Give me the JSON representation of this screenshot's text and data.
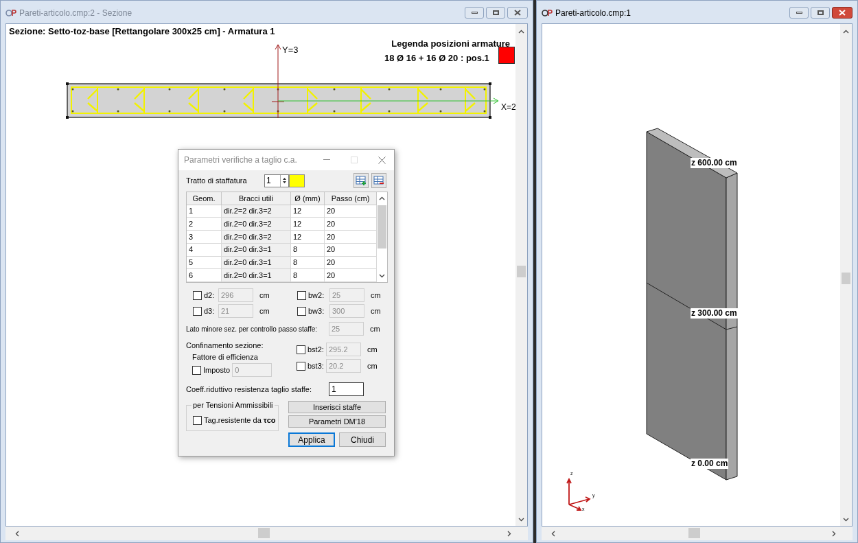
{
  "windows": [
    {
      "kind": "section",
      "title": "Pareti-articolo.cmp:2 - Sezione",
      "active": false,
      "heading": "Sezione: Setto-toz-base [Rettangolare 300x25 cm] - Armatura 1",
      "legend": {
        "title": "Legenda posizioni armature",
        "entry": "18 Ø 16 + 16 Ø 20 : pos.1",
        "color": "#ff0000"
      },
      "axis_labels": [
        "Y=3",
        "X=2"
      ]
    },
    {
      "kind": "view3d",
      "title": "Pareti-articolo.cmp:1",
      "active": true,
      "level_labels": [
        "z 600.00 cm",
        "z 300.00 cm",
        "z 0.00 cm"
      ],
      "axis_labels": [
        "z",
        "y",
        "x"
      ]
    }
  ],
  "dialog": {
    "title": "Parametri verifiche a taglio c.a.",
    "tratto": {
      "label": "Tratto di staffatura",
      "value": "1",
      "color": "#ffff00"
    },
    "table": {
      "columns": [
        "Geom.",
        "Bracci utili",
        "Ø (mm)",
        "Passo (cm)"
      ],
      "rows": [
        [
          "1",
          "dir.2=2 dir.3=2",
          "12",
          "20"
        ],
        [
          "2",
          "dir.2=0 dir.3=2",
          "12",
          "20"
        ],
        [
          "3",
          "dir.2=0 dir.3=2",
          "12",
          "20"
        ],
        [
          "4",
          "dir.2=0 dir.3=1",
          "8",
          "20"
        ],
        [
          "5",
          "dir.2=0 dir.3=1",
          "8",
          "20"
        ],
        [
          "6",
          "dir.2=0 dir.3=1",
          "8",
          "20"
        ]
      ]
    },
    "checked_fields": [
      {
        "label": "d2:",
        "value": "296",
        "unit": "cm",
        "checked": false
      },
      {
        "label": "bw2:",
        "value": "25",
        "unit": "cm",
        "checked": false
      },
      {
        "label": "d3:",
        "value": "21",
        "unit": "cm",
        "checked": false
      },
      {
        "label": "bw3:",
        "value": "300",
        "unit": "cm",
        "checked": false
      }
    ],
    "lato": {
      "label": "Lato minore sez. per controllo passo staffe:",
      "value": "25",
      "unit": "cm"
    },
    "confinamento": {
      "label": "Confinamento sezione:",
      "sublabel": "Fattore di efficienza",
      "imposto": {
        "label": "Imposto",
        "value": "0",
        "checked": false
      },
      "bst": [
        {
          "label": "bst2:",
          "value": "295.2",
          "unit": "cm",
          "checked": false
        },
        {
          "label": "bst3:",
          "value": "20.2",
          "unit": "cm",
          "checked": false
        }
      ]
    },
    "coeff": {
      "label": "Coeff.riduttivo resistenza taglio staffe:",
      "value": "1"
    },
    "group": {
      "title": "per Tensioni Ammissibili",
      "checkbox": {
        "label": "Tag.resistente da **τco**",
        "checked": false
      }
    },
    "buttons": [
      "Inserisci staffe",
      "Parametri DM'18",
      "Applica",
      "Chiudi"
    ]
  }
}
